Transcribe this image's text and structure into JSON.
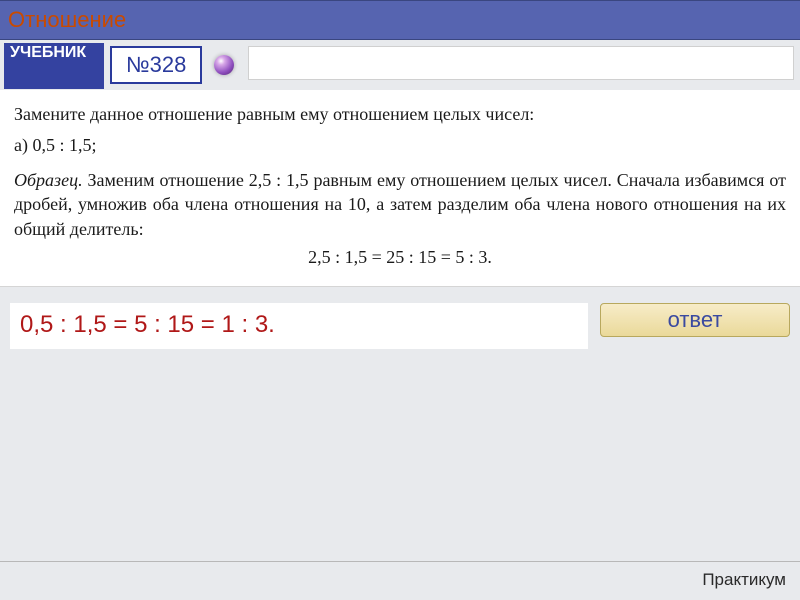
{
  "header": {
    "title": "Отношение"
  },
  "toolbar": {
    "textbook_label": "УЧЕБНИК",
    "problem_number": "№328"
  },
  "content": {
    "prompt": "Замените данное отношение равным ему отношением целых чисел:",
    "item_a": "а) 0,5 : 1,5;",
    "sample_lead": "Образец.",
    "sample_rest": " Заменим отношение 2,5 : 1,5 равным ему отношением целых чисел. Сначала избавимся от дробей, умножив оба члена отношения на 10, а затем разделим оба члена нового отношения на их общий делитель:",
    "equation": "2,5 : 1,5 = 25 : 15 = 5 : 3."
  },
  "answer": {
    "text": "0,5 : 1,5 = 5 : 15 = 1 : 3.",
    "button_label": "ответ"
  },
  "footer": {
    "label": "Практикум"
  }
}
